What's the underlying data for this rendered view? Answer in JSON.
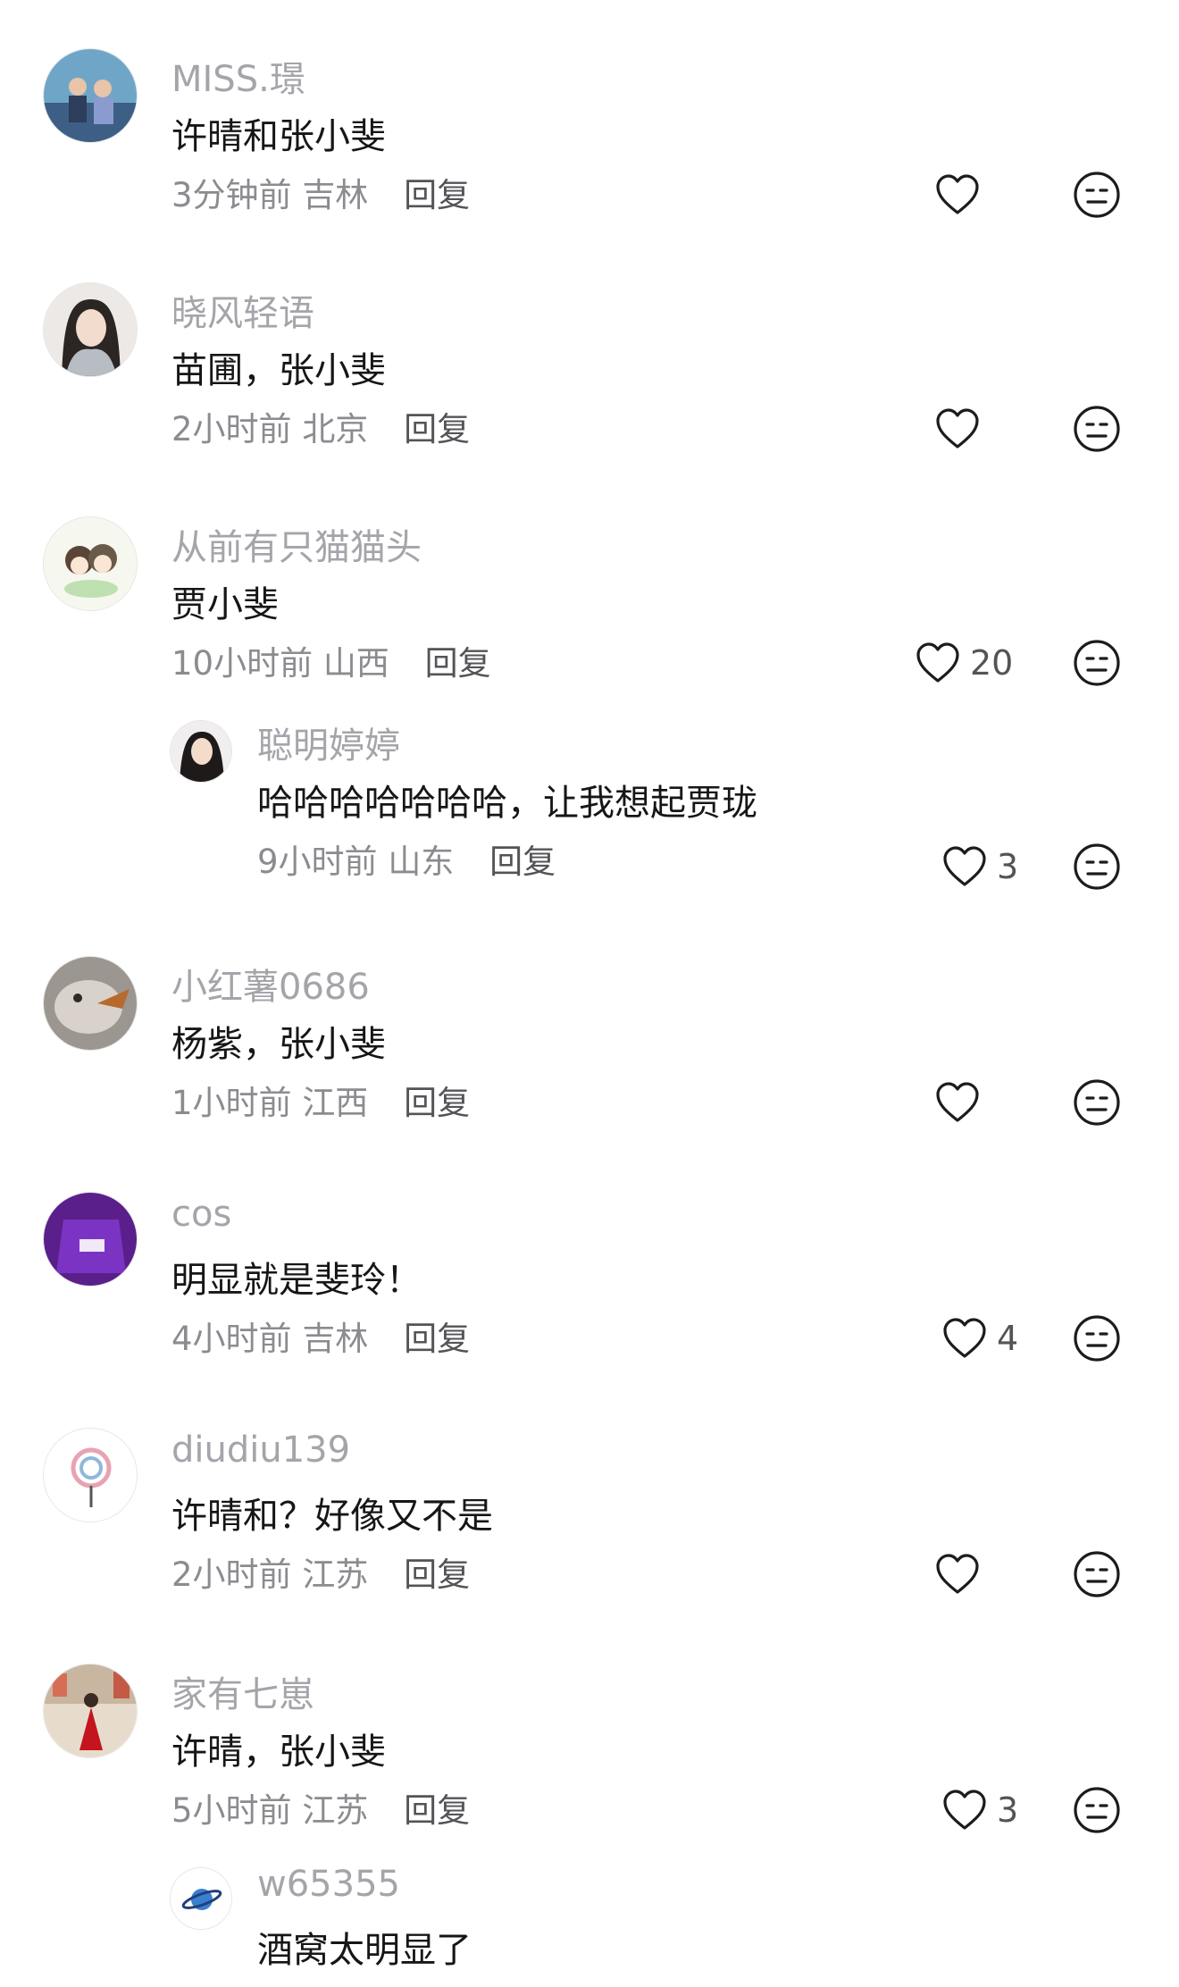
{
  "comments": [
    {
      "username": "MISS.璟",
      "text": "许晴和张小斐",
      "time": "3分钟前",
      "location": "吉林",
      "reply": "回复",
      "likes": ""
    },
    {
      "username": "晓风轻语",
      "text": "苗圃，张小斐",
      "time": "2小时前",
      "location": "北京",
      "reply": "回复",
      "likes": ""
    },
    {
      "username": "从前有只猫猫头",
      "text": "贾小斐",
      "time": "10小时前",
      "location": "山西",
      "reply": "回复",
      "likes": "20",
      "replies": [
        {
          "username": "聪明婷婷",
          "text": "哈哈哈哈哈哈哈，让我想起贾珑",
          "time": "9小时前",
          "location": "山东",
          "reply": "回复",
          "likes": "3"
        }
      ]
    },
    {
      "username": "小红薯0686",
      "text": "杨紫，张小斐",
      "time": "1小时前",
      "location": "江西",
      "reply": "回复",
      "likes": ""
    },
    {
      "username": "cos",
      "text": "明显就是斐玲！",
      "time": "4小时前",
      "location": "吉林",
      "reply": "回复",
      "likes": "4"
    },
    {
      "username": "diudiu139",
      "text": "许晴和？好像又不是",
      "time": "2小时前",
      "location": "江苏",
      "reply": "回复",
      "likes": ""
    },
    {
      "username": "家有七崽",
      "text": "许晴，张小斐",
      "time": "5小时前",
      "location": "江苏",
      "reply": "回复",
      "likes": "3",
      "replies": [
        {
          "username": "w65355",
          "text": "酒窝太明显了"
        }
      ]
    }
  ],
  "icons": {
    "like": "heart-outline-icon",
    "dislike": "neutral-face-icon"
  }
}
